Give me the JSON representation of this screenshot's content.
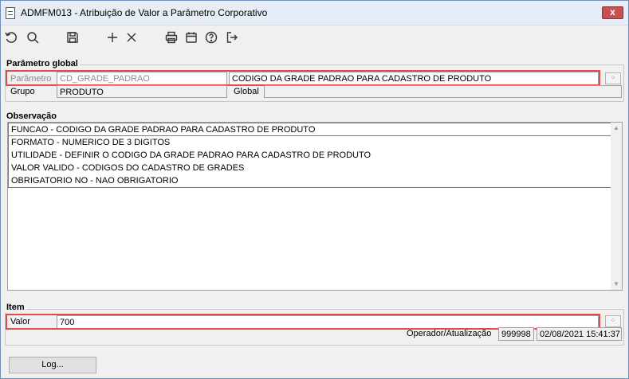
{
  "window": {
    "title": "ADMFM013 - Atribuição de Valor a Parâmetro Corporativo",
    "close_label": "x"
  },
  "toolbar": {
    "icons": [
      "undo-icon",
      "search-icon",
      "save-icon",
      "add-icon",
      "delete-icon",
      "print-icon",
      "calendar-icon",
      "help-icon",
      "exit-icon"
    ]
  },
  "parametro_global": {
    "section_title": "Parâmetro global",
    "parametro_label": "Parâmetro",
    "parametro_code": "CD_GRADE_PADRAO",
    "parametro_description": "CODIGO DA GRADE PADRAO PARA CADASTRO DE PRODUTO",
    "grupo_label": "Grupo",
    "grupo_value": "PRODUTO",
    "global_label": "Global",
    "global_value": ""
  },
  "observacao": {
    "section_title": "Observação",
    "lines": [
      "FUNCAO - CODIGO DA GRADE PADRAO PARA CADASTRO DE PRODUTO",
      "FORMATO - NUMERICO DE 3 DIGITOS",
      "UTILIDADE - DEFINIR O CODIGO DA GRADE PADRAO PARA CADASTRO DE PRODUTO",
      "VALOR VALIDO - CODIGOS DO CADASTRO DE GRADES",
      "OBRIGATORIO NO - NAO OBRIGATORIO"
    ]
  },
  "item": {
    "section_title": "Item",
    "valor_label": "Valor",
    "valor_value": "700",
    "operador_label": "Operador/Atualização",
    "operador_value": "999998",
    "data_atualizacao": "02/08/2021 15:41:37"
  },
  "footer": {
    "log_button": "Log..."
  },
  "colors": {
    "highlight": "#e34a4a",
    "titlebar": "#e6edf7",
    "close": "#c75050"
  }
}
